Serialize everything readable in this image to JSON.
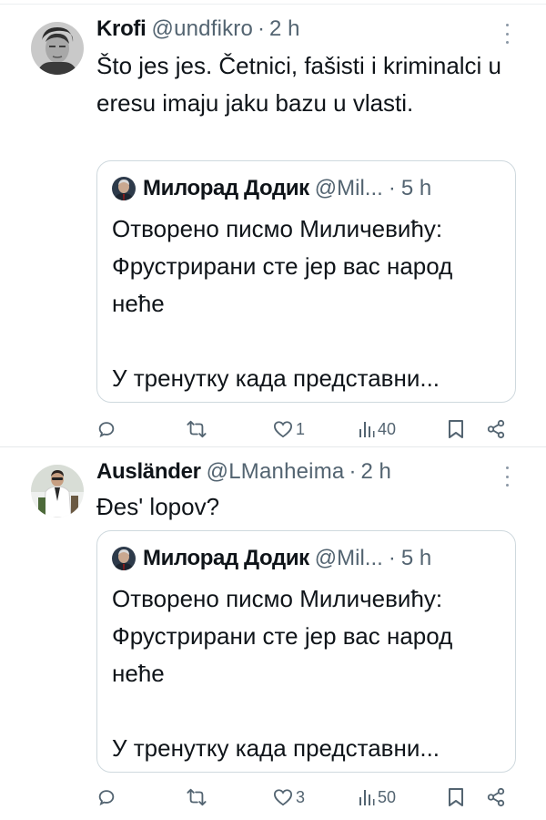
{
  "tweets": [
    {
      "name": "Krofi",
      "handle": "@undfikro",
      "dot": "·",
      "time": "2 h",
      "text": "Što jes jes. Četnici, fašisti i kriminalci u eresu imaju jaku bazu u vlasti.",
      "quote": {
        "name": "Милорад Додик",
        "handle": "@Mil...",
        "dot": "·",
        "time": "5 h",
        "line1": "Отворено писмо Миличевићу: Фрустрирани сте јер вас народ нећe",
        "line2": "У тренутку када представни..."
      },
      "actions": {
        "likes": "1",
        "views": "40"
      }
    },
    {
      "name": "Ausländer",
      "handle": "@LManheima",
      "dot": "·",
      "time": "2 h",
      "text": "Đes' lopov?",
      "quote": {
        "name": "Милорад Додик",
        "handle": "@Mil...",
        "dot": "·",
        "time": "5 h",
        "line1": "Отворено писмо Миличевићу: Фрустрирани сте јер вас народ нећe",
        "line2": "У тренутку када представни..."
      },
      "actions": {
        "likes": "3",
        "views": "50"
      }
    }
  ],
  "icons": {
    "reply": "reply-icon",
    "retweet": "retweet-icon",
    "like": "heart-icon",
    "views": "views-icon",
    "bookmark": "bookmark-icon",
    "share": "share-icon",
    "more": "more-icon"
  },
  "colors": {
    "text": "#0f1419",
    "secondary": "#536471",
    "border": "#cfd9de"
  }
}
